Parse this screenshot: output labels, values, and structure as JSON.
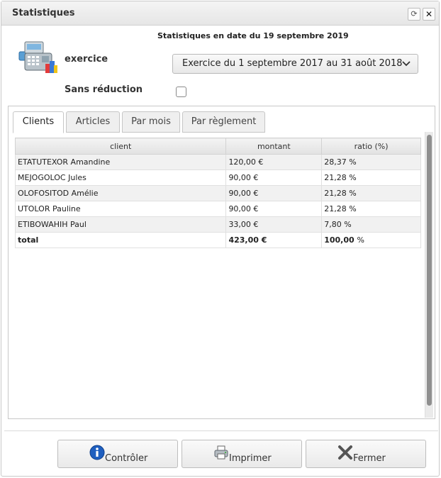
{
  "window": {
    "title": "Statistiques"
  },
  "header": {
    "stamp": "Statistiques en date du 19 septembre 2019"
  },
  "form": {
    "exercice_label": "exercice",
    "exercice_value": "Exercice du 1 septembre 2017 au 31 août 2018",
    "sans_reduction_label": "Sans réduction",
    "sans_reduction_checked": false
  },
  "tabs": [
    {
      "label": "Clients",
      "active": true
    },
    {
      "label": "Articles",
      "active": false
    },
    {
      "label": "Par mois",
      "active": false
    },
    {
      "label": "Par règlement",
      "active": false
    }
  ],
  "table": {
    "columns": [
      "client",
      "montant",
      "ratio (%)"
    ],
    "rows": [
      {
        "client": "ETATUTEXOR Amandine",
        "montant": "120,00 €",
        "ratio": "28,37 %"
      },
      {
        "client": "MEJOGOLOC Jules",
        "montant": "90,00 €",
        "ratio": "21,28 %"
      },
      {
        "client": "OLOFOSITOD Amélie",
        "montant": "90,00 €",
        "ratio": "21,28 %"
      },
      {
        "client": "UTOLOR Pauline",
        "montant": "90,00 €",
        "ratio": "21,28 %"
      },
      {
        "client": "ETIBOWAHIH Paul",
        "montant": "33,00 €",
        "ratio": "7,80 %"
      }
    ],
    "total": {
      "client": "total",
      "montant": "423,00 €",
      "ratio_value": "100,00",
      "ratio_unit": "%"
    }
  },
  "buttons": {
    "controler": "Contrôler",
    "imprimer": "Imprimer",
    "fermer": "Fermer"
  },
  "icons": {
    "refresh": "refresh-icon",
    "close": "close-icon",
    "register": "cash-register-icon",
    "info": "info-icon",
    "printer": "printer-icon",
    "cancel": "cancel-icon"
  },
  "colors": {
    "info_blue": "#1f5fbf",
    "cancel_gray": "#555555"
  }
}
